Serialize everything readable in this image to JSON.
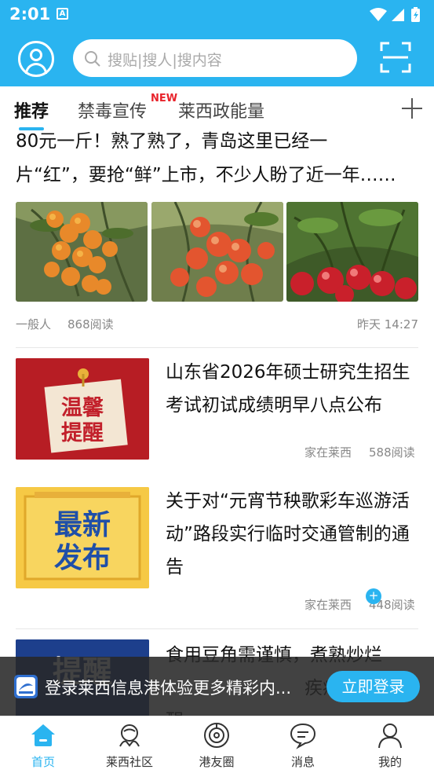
{
  "status_bar": {
    "time": "2:01",
    "notification_icon": "A"
  },
  "header": {
    "search_placeholder": "搜贴|搜人|搜内容"
  },
  "tabs": [
    {
      "label": "推荐",
      "active": true
    },
    {
      "label": "禁毒宣传",
      "badge": "NEW"
    },
    {
      "label": "莱西政能量"
    }
  ],
  "feed": {
    "top_article": {
      "title_line1": "80元一斤！熟了熟了，青岛这里已经一",
      "title_line2": "片“红”，要抢“鲜”上市，不少人盼了近一年……",
      "author": "一般人",
      "reads": "868阅读",
      "time": "昨天 14:27"
    },
    "articles": [
      {
        "title": "山东省2026年硕士研究生招生考试初试成绩明早八点公布",
        "image_text_1": "温馨",
        "image_text_2": "提醒",
        "source": "家在莱西",
        "reads": "588阅读"
      },
      {
        "title": "关于对“元宵节秧歌彩车巡游活动”路段实行临时交通管制的通告",
        "image_text_1": "最新",
        "image_text_2": "发布",
        "source": "家在莱西",
        "reads": "448阅读"
      },
      {
        "title_line1": "食用豆角需谨慎，煮熟炒烂",
        "title_line2": "疾病",
        "title_line3": "醒",
        "image_text_1": "提醒"
      }
    ]
  },
  "login_bar": {
    "text": "登录莱西信息港体验更多精彩内...",
    "button": "立即登录"
  },
  "bottom_nav": [
    {
      "label": "首页",
      "icon": "home-icon",
      "active": true
    },
    {
      "label": "莱西社区",
      "icon": "community-icon"
    },
    {
      "label": "港友圈",
      "icon": "circle-icon"
    },
    {
      "label": "消息",
      "icon": "message-icon"
    },
    {
      "label": "我的",
      "icon": "profile-icon"
    }
  ],
  "colors": {
    "brand": "#2ab4f0",
    "badge_red": "#e8232b"
  }
}
